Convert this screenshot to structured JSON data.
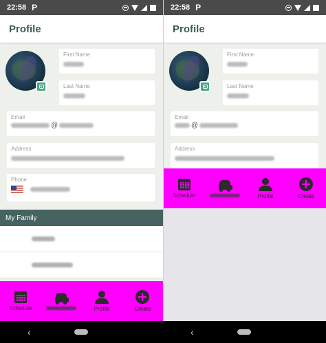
{
  "screens": [
    {
      "status": {
        "time": "22:58",
        "app_glyph": "P"
      },
      "title": "Profile",
      "fields": {
        "first_name": "First Name",
        "last_name": "Last Name",
        "email": "Email",
        "email_at": "@",
        "address": "Address",
        "phone": "Phone"
      },
      "family": {
        "header": "My Family"
      },
      "tabs": [
        {
          "label": "Schedule",
          "icon": "calendar-icon"
        },
        {
          "label": "",
          "icon": "car-icon"
        },
        {
          "label": "Profile",
          "icon": "person-icon"
        },
        {
          "label": "Create",
          "icon": "plus-circle-icon"
        }
      ]
    },
    {
      "status": {
        "time": "22:58",
        "app_glyph": "P"
      },
      "title": "Profile",
      "fields": {
        "first_name": "First Name",
        "last_name": "Last Name",
        "email": "Email",
        "email_at": "@",
        "address": "Address"
      },
      "tabs": [
        {
          "label": "Schedule",
          "icon": "calendar-icon"
        },
        {
          "label": "",
          "icon": "car-icon"
        },
        {
          "label": "Profile",
          "icon": "person-icon"
        },
        {
          "label": "Create",
          "icon": "plus-circle-icon"
        }
      ]
    }
  ],
  "colors": {
    "title": "#3d5c57",
    "family_header_bg": "#466360",
    "tabbar_bg": "#ff00ff",
    "camera_badge": "#4aa884"
  },
  "nav": {
    "back_glyph": "‹"
  }
}
